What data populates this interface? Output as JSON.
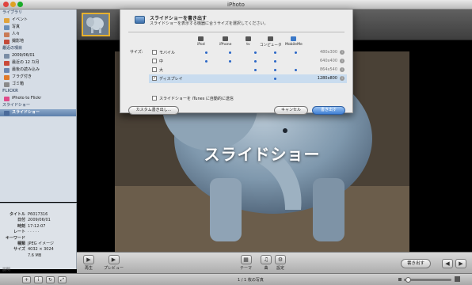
{
  "window": {
    "title": "iPhoto"
  },
  "sidebar": {
    "sections": [
      {
        "label": "ライブラリ",
        "items": [
          {
            "label": "イベント",
            "icon": "events-icon",
            "color": "#e0a33a"
          },
          {
            "label": "写真",
            "icon": "photos-icon",
            "color": "#6a8fb8"
          },
          {
            "label": "人々",
            "icon": "faces-icon",
            "color": "#c97a55"
          },
          {
            "label": "撮影地",
            "icon": "places-icon",
            "color": "#c34a3a"
          }
        ]
      },
      {
        "label": "最近の項目",
        "items": [
          {
            "label": "2009/06/01",
            "icon": "event-icon",
            "color": "#7a8da5"
          },
          {
            "label": "最近の 12 カ月",
            "icon": "calendar-icon",
            "color": "#c94a3a"
          },
          {
            "label": "最後の読み込み",
            "icon": "import-icon",
            "color": "#6b86b0"
          },
          {
            "label": "フラグ付き",
            "icon": "flag-icon",
            "color": "#e07a2a"
          },
          {
            "label": "ゴミ箱",
            "icon": "trash-icon",
            "color": "#8a8a8a"
          }
        ]
      },
      {
        "label": "FLICKR",
        "items": [
          {
            "label": "iPhoto to Flickr",
            "icon": "flickr-icon",
            "color": "#e04a8a"
          }
        ]
      },
      {
        "label": "スライドショー",
        "items": [
          {
            "label": "スライドショー",
            "icon": "slideshow-icon",
            "color": "#4a6a9a",
            "selected": true
          }
        ]
      }
    ]
  },
  "info": {
    "rows": [
      {
        "key": "タイトル",
        "value": "P6017316"
      },
      {
        "key": "日付",
        "value": "2009/06/01"
      },
      {
        "key": "時刻",
        "value": "17:12:07"
      },
      {
        "key": "レート",
        "value": "· · · · ·"
      },
      {
        "key": "キーワード",
        "value": ""
      },
      {
        "key": "種類",
        "value": "JPEG イメージ"
      },
      {
        "key": "サイズ",
        "value": "4032 × 3024"
      },
      {
        "key": "",
        "value": "7.6 MB"
      }
    ],
    "description_label": "説明"
  },
  "viewer": {
    "overlay_title": "スライドショー"
  },
  "toolbar": {
    "play": "再生",
    "preview": "プレビュー",
    "theme": "テーマ",
    "music": "曲",
    "settings": "設定",
    "export": "書き出す"
  },
  "status": {
    "count": "1 / 1 枚の写真"
  },
  "export_sheet": {
    "title": "スライドショーを書き出す",
    "subtitle": "スライドショーを表示する機器に合うサイズを選択してください。",
    "devices": [
      "iPod",
      "iPhone",
      "tv",
      "コンピュータ",
      "MobileMe"
    ],
    "size_label": "サイズ:",
    "options": [
      {
        "name": "モバイル",
        "resolution": "480x300",
        "checked": false,
        "selected": false
      },
      {
        "name": "中",
        "resolution": "640x400",
        "checked": false,
        "selected": false
      },
      {
        "name": "大",
        "resolution": "864x540",
        "checked": false,
        "selected": false
      },
      {
        "name": "ディスプレイ",
        "resolution": "1280x800",
        "checked": true,
        "selected": true
      }
    ],
    "itunes_label": "スライドショーを iTunes に自動的に送信",
    "custom_button": "カスタム書き出し...",
    "cancel_button": "キャンセル",
    "export_button": "書き出す"
  }
}
